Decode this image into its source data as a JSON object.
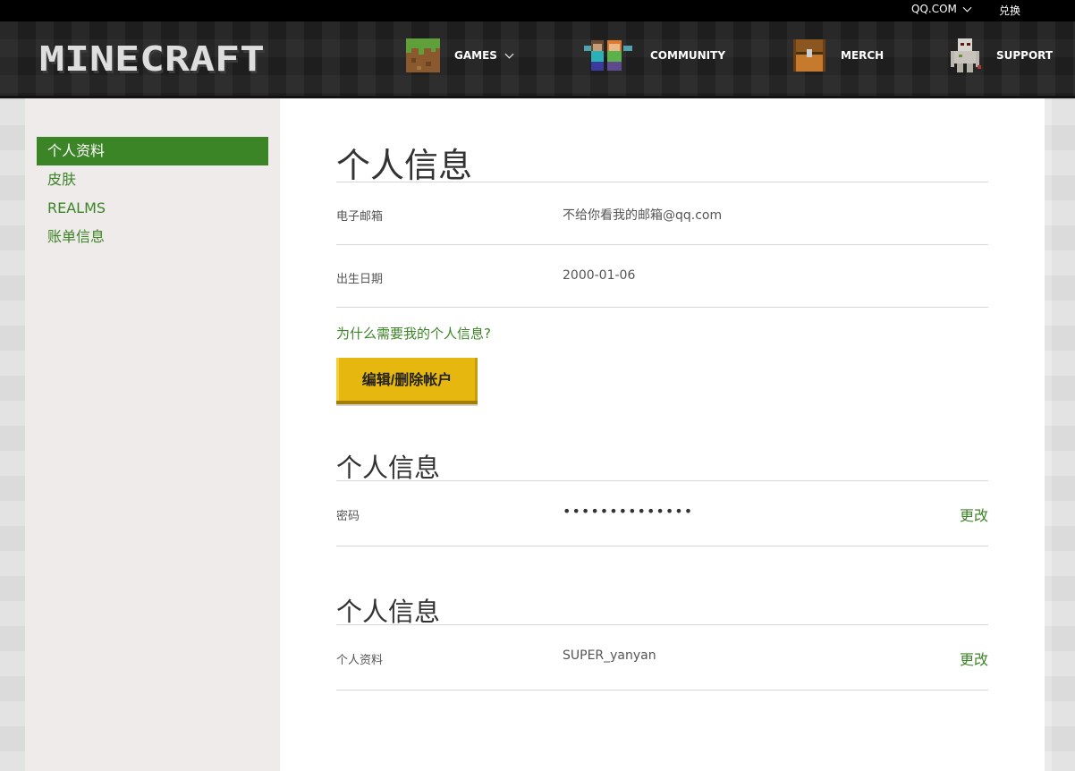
{
  "topbar": {
    "region": "QQ.COM",
    "redeem": "兑换"
  },
  "nav": {
    "logo": "MINECRAFT",
    "items": [
      {
        "label": "GAMES",
        "icon": "grass-block-icon",
        "has_dropdown": true
      },
      {
        "label": "COMMUNITY",
        "icon": "characters-icon",
        "has_dropdown": false
      },
      {
        "label": "MERCH",
        "icon": "chest-icon",
        "has_dropdown": false
      },
      {
        "label": "SUPPORT",
        "icon": "iron-golem-icon",
        "has_dropdown": false
      }
    ]
  },
  "sidebar": {
    "items": [
      {
        "label": "个人资料",
        "active": true
      },
      {
        "label": "皮肤",
        "active": false
      },
      {
        "label": "REALMS",
        "active": false
      },
      {
        "label": "账单信息",
        "active": false
      }
    ]
  },
  "main": {
    "section1": {
      "title": "个人信息",
      "rows": [
        {
          "label": "电子邮箱",
          "value": "不给你看我的邮箱@qq.com"
        },
        {
          "label": "出生日期",
          "value": "2000-01-06"
        }
      ],
      "why_link": "为什么需要我的个人信息?",
      "edit_button": "编辑/删除帐户"
    },
    "section2": {
      "title": "个人信息",
      "row": {
        "label": "密码",
        "value": "••••••••••••••",
        "action": "更改"
      }
    },
    "section3": {
      "title": "个人信息",
      "row": {
        "label": "个人资料",
        "value": "SUPER_yanyan",
        "action": "更改"
      }
    }
  },
  "colors": {
    "accent_green": "#3c8527",
    "button_yellow": "#e6b80f",
    "nav_bg": "#1e1e1e"
  }
}
